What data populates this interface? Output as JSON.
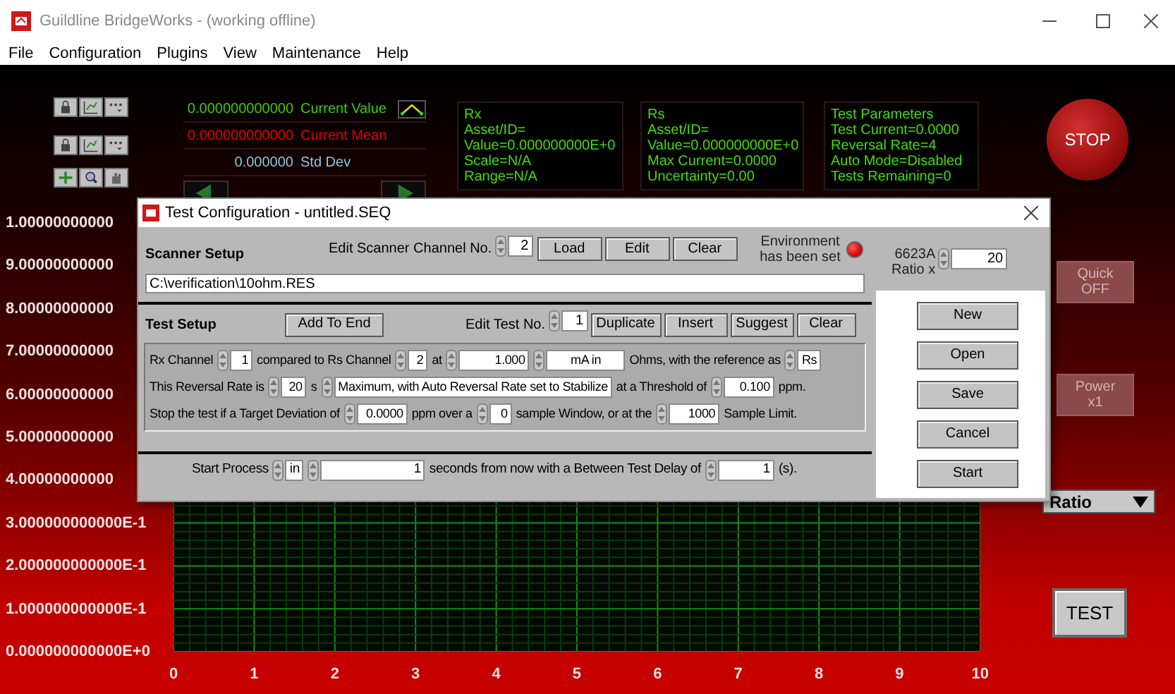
{
  "window": {
    "title": "Guildline BridgeWorks - (working offline)"
  },
  "menu": [
    "File",
    "Configuration",
    "Plugins",
    "View",
    "Maintenance",
    "Help"
  ],
  "readouts": [
    {
      "value": "0.000000000000",
      "label": "Current Value",
      "color": "#3ccc00"
    },
    {
      "value": "0.000000000000",
      "label": "Current Mean",
      "color": "#e00000"
    },
    {
      "value": "0.000000",
      "label": "Std Dev",
      "color": "#8cc8e0"
    }
  ],
  "info_panels": [
    {
      "lines": [
        "Rx",
        "Asset/ID=",
        "Value=0.000000000E+0",
        "Scale=N/A",
        "Range=N/A"
      ]
    },
    {
      "lines": [
        "Rs",
        "Asset/ID=",
        "Value=0.000000000E+0",
        "Max Current=0.0000",
        "Uncertainty=0.00"
      ]
    },
    {
      "lines": [
        "Test Parameters",
        "Test Current=0.0000",
        "Reversal Rate=4",
        "Auto Mode=Disabled",
        "Tests Remaining=0"
      ]
    }
  ],
  "stop_button": "STOP",
  "side_buttons": [
    {
      "lines": [
        "Quick",
        "OFF"
      ],
      "disabled": true
    },
    {
      "lines": [
        "Power",
        "x1"
      ],
      "disabled": true
    }
  ],
  "plot_select": "Ratio",
  "test_button": "TEST",
  "graph": {
    "y_labels": [
      "1.00000000000",
      "9.00000000000",
      "8.00000000000",
      "7.00000000000",
      "6.00000000000",
      "5.00000000000",
      "4.00000000000",
      "3.000000000000E-1",
      "2.000000000000E-1",
      "1.000000000000E-1",
      "0.000000000000E+0"
    ],
    "x_labels": [
      "0",
      "1",
      "2",
      "3",
      "4",
      "5",
      "6",
      "7",
      "8",
      "9",
      "10"
    ]
  },
  "dialog": {
    "title": "Test Configuration - untitled.SEQ",
    "scanner_setup": {
      "heading": "Scanner Setup",
      "channel_label": "Edit Scanner Channel No.",
      "channel": "2",
      "buttons": [
        "Load",
        "Edit",
        "Clear"
      ],
      "path": "C:\\verification\\10ohm.RES"
    },
    "environment": {
      "lines": [
        "Environment",
        "has been set"
      ],
      "on": true
    },
    "ratio": {
      "lines": [
        "6623A",
        "Ratio x"
      ],
      "value": "20"
    },
    "test_setup": {
      "heading": "Test Setup",
      "add_button": "Add To End",
      "test_no_label": "Edit Test No.",
      "test_no": "1",
      "buttons": [
        "Duplicate",
        "Insert",
        "Suggest",
        "Clear"
      ],
      "lines": [
        {
          "items": [
            {
              "kind": "text",
              "text": "Rx Channel"
            },
            {
              "kind": "number",
              "value": "1"
            },
            {
              "kind": "text",
              "text": "compared to Rs Channel"
            },
            {
              "kind": "number",
              "value": "2"
            },
            {
              "kind": "text",
              "text": "at"
            },
            {
              "kind": "number",
              "value": "1.000"
            },
            {
              "kind": "ring",
              "value": "mA in"
            },
            {
              "kind": "text",
              "text": "Ohms, with the reference as"
            },
            {
              "kind": "ring",
              "value": "Rs"
            }
          ]
        },
        {
          "items": [
            {
              "kind": "text",
              "text": "This Reversal Rate is"
            },
            {
              "kind": "number",
              "value": "20"
            },
            {
              "kind": "text",
              "text": "s"
            },
            {
              "kind": "ring",
              "value": "Maximum, with Auto Reversal Rate set to Stabilize"
            },
            {
              "kind": "text",
              "text": "at a Threshold of"
            },
            {
              "kind": "number",
              "value": "0.100"
            },
            {
              "kind": "text",
              "text": "ppm."
            }
          ]
        },
        {
          "items": [
            {
              "kind": "text",
              "text": "Stop the test if a Target Deviation of"
            },
            {
              "kind": "number",
              "value": "0.0000"
            },
            {
              "kind": "text",
              "text": "ppm over a"
            },
            {
              "kind": "number",
              "value": "0"
            },
            {
              "kind": "text",
              "text": "sample Window, or at the"
            },
            {
              "kind": "number",
              "value": "1000"
            },
            {
              "kind": "text",
              "text": "Sample Limit."
            }
          ]
        }
      ]
    },
    "start_row": {
      "items": [
        {
          "kind": "text",
          "text": "Start Process"
        },
        {
          "kind": "ring",
          "value": "in"
        },
        {
          "kind": "number",
          "value": "1"
        },
        {
          "kind": "text",
          "text": "seconds from now with a Between Test Delay of"
        },
        {
          "kind": "number",
          "value": "1"
        },
        {
          "kind": "text",
          "text": "(s)."
        }
      ]
    },
    "side_buttons": [
      "New",
      "Open",
      "Save",
      "Cancel",
      "Start"
    ]
  }
}
